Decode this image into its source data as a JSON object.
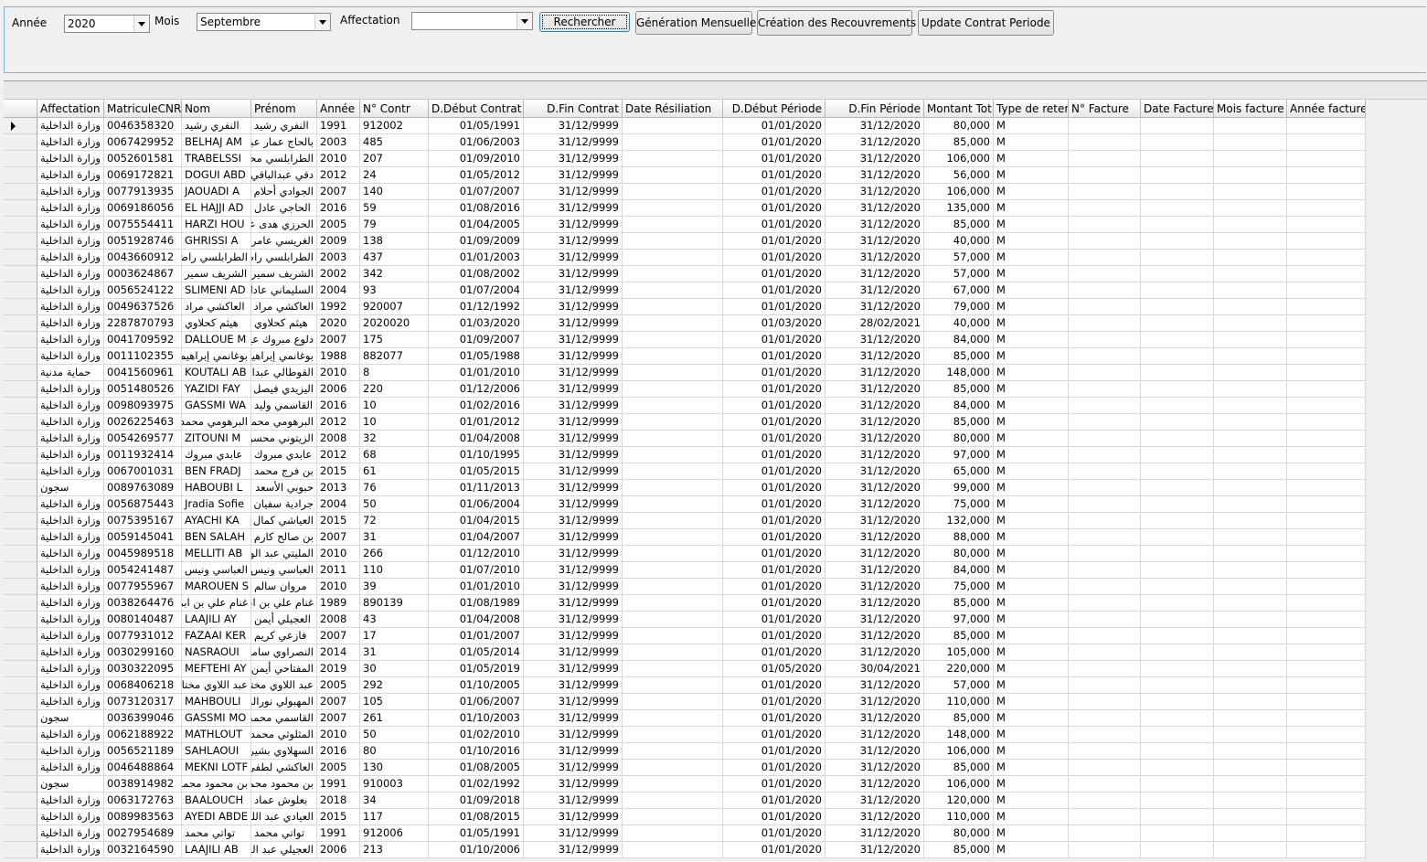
{
  "filters": {
    "annee_label": "Année",
    "annee_value": "2020",
    "mois_label": "Mois",
    "mois_value": "Septembre",
    "affectation_label": "Affectation",
    "affectation_value": ""
  },
  "buttons": {
    "rechercher": "Rechercher",
    "generation": "Génération Mensuelle",
    "creation": "Création des Recouvrements",
    "update": "Update Contrat Periode"
  },
  "grid": {
    "columns": [
      "Affectation",
      "MatriculeCNR",
      "Nom",
      "Prénom",
      "Année",
      "N° Contr",
      "D.Début Contrat",
      "D.Fin Contrat",
      "Date Résiliation",
      "D.Début Période",
      "D.Fin Période",
      "Montant Tot",
      "Type de reten",
      "N° Facture",
      "Date Facture",
      "Mois facture",
      "Année facture"
    ],
    "rows": [
      [
        "وزارة الداخلية",
        "0046358320",
        "النفري رشيد",
        "النفري رشيد",
        "1991",
        "912002",
        "01/05/1991",
        "31/12/9999",
        "",
        "01/01/2020",
        "31/12/2020",
        "80,000",
        "M",
        "",
        "",
        "",
        ""
      ],
      [
        "وزارة الداخلية",
        "0067429952",
        "BELHAJ AM",
        "بالحاج عمار عبد",
        "2003",
        "485",
        "01/06/2003",
        "31/12/9999",
        "",
        "01/01/2020",
        "31/12/2020",
        "85,000",
        "M",
        "",
        "",
        "",
        ""
      ],
      [
        "وزارة الداخلية",
        "0052601581",
        "TRABELSSI",
        "الطرابلسي محمد",
        "2010",
        "207",
        "01/09/2010",
        "31/12/9999",
        "",
        "01/01/2020",
        "31/12/2020",
        "106,000",
        "M",
        "",
        "",
        "",
        ""
      ],
      [
        "وزارة الداخلية",
        "0069172821",
        "DOGUI ABD",
        "دقي عبدالباقي",
        "2012",
        "24",
        "01/05/2012",
        "31/12/9999",
        "",
        "01/01/2020",
        "31/12/2020",
        "56,000",
        "M",
        "",
        "",
        "",
        ""
      ],
      [
        "وزارة الداخلية",
        "0077913935",
        "JAOUADI A",
        "الجوادي أحلام",
        "2007",
        "140",
        "01/07/2007",
        "31/12/9999",
        "",
        "01/01/2020",
        "31/12/2020",
        "106,000",
        "M",
        "",
        "",
        "",
        ""
      ],
      [
        "وزارة الداخلية",
        "0069186056",
        "EL HAJJI AD",
        "الحاجي عادل",
        "2016",
        "59",
        "01/08/2016",
        "31/12/9999",
        "",
        "01/01/2020",
        "31/12/2020",
        "135,000",
        "M",
        "",
        "",
        "",
        ""
      ],
      [
        "وزارة الداخلية",
        "0075554411",
        "HARZI HOU",
        "الحرزي هدى عد",
        "2005",
        "79",
        "01/04/2005",
        "31/12/9999",
        "",
        "01/01/2020",
        "31/12/2020",
        "85,000",
        "M",
        "",
        "",
        "",
        ""
      ],
      [
        "وزارة الداخلية",
        "0051928746",
        "GHRISSI A",
        "الغريسي عامر",
        "2009",
        "138",
        "01/09/2009",
        "31/12/9999",
        "",
        "01/01/2020",
        "31/12/2020",
        "40,000",
        "M",
        "",
        "",
        "",
        ""
      ],
      [
        "وزارة الداخلية",
        "0043660912",
        "الطرابلسي راضيا",
        "الطرابلسي راضي",
        "2003",
        "437",
        "01/01/2003",
        "31/12/9999",
        "",
        "01/01/2020",
        "31/12/2020",
        "57,000",
        "M",
        "",
        "",
        "",
        ""
      ],
      [
        "وزارة الداخلية",
        "0003624867",
        "الشريف سمير",
        "الشريف سمير",
        "2002",
        "342",
        "01/08/2002",
        "31/12/9999",
        "",
        "01/01/2020",
        "31/12/2020",
        "57,000",
        "M",
        "",
        "",
        "",
        ""
      ],
      [
        "وزارة الداخلية",
        "0056524122",
        "SLIMENI AD",
        "السليماني عادل",
        "2004",
        "93",
        "01/07/2004",
        "31/12/9999",
        "",
        "01/01/2020",
        "31/12/2020",
        "67,000",
        "M",
        "",
        "",
        "",
        ""
      ],
      [
        "وزارة الداخلية",
        "0049637526",
        "العاكشي مراد",
        "العاكشي مراد",
        "1992",
        "920007",
        "01/12/1992",
        "31/12/9999",
        "",
        "01/01/2020",
        "31/12/2020",
        "79,000",
        "M",
        "",
        "",
        "",
        ""
      ],
      [
        "وزارة الداخلية",
        "2287870793",
        "هيثم كحلاوي",
        "هيثم كحلاوي",
        "2020",
        "2020020",
        "01/03/2020",
        "31/12/9999",
        "",
        "01/03/2020",
        "28/02/2021",
        "40,000",
        "M",
        "",
        "",
        "",
        ""
      ],
      [
        "وزارة الداخلية",
        "0041709592",
        "DALLOUE M",
        "دلوع مبروك عياد",
        "2007",
        "175",
        "01/09/2007",
        "31/12/9999",
        "",
        "01/01/2020",
        "31/12/2020",
        "84,000",
        "M",
        "",
        "",
        "",
        ""
      ],
      [
        "وزارة الداخلية",
        "0011102355",
        "بوغانمي إبراهيم",
        "بوغانمي إبراهيم",
        "1988",
        "882077",
        "01/05/1988",
        "31/12/9999",
        "",
        "01/01/2020",
        "31/12/2020",
        "85,000",
        "M",
        "",
        "",
        "",
        ""
      ],
      [
        "حماية مدنية",
        "0041560961",
        "KOUTALI AB",
        "القوطالي عبدالرح",
        "2010",
        "8",
        "01/01/2010",
        "31/12/9999",
        "",
        "01/01/2020",
        "31/12/2020",
        "148,000",
        "M",
        "",
        "",
        "",
        ""
      ],
      [
        "وزارة الداخلية",
        "0051480526",
        "YAZIDI FAY",
        "اليزيدي فيصل",
        "2006",
        "220",
        "01/12/2006",
        "31/12/9999",
        "",
        "01/01/2020",
        "31/12/2020",
        "85,000",
        "M",
        "",
        "",
        "",
        ""
      ],
      [
        "وزارة الداخلية",
        "0098093975",
        "GASSMI WA",
        "القاسمي وليد",
        "2016",
        "10",
        "01/02/2016",
        "31/12/9999",
        "",
        "01/01/2020",
        "31/12/2020",
        "84,000",
        "M",
        "",
        "",
        "",
        ""
      ],
      [
        "وزارة الداخلية",
        "0026225463",
        "البرهومي محمد",
        "البرهومي محمد",
        "2012",
        "10",
        "01/01/2012",
        "31/12/9999",
        "",
        "01/01/2020",
        "31/12/2020",
        "85,000",
        "M",
        "",
        "",
        "",
        ""
      ],
      [
        "وزارة الداخلية",
        "0054269577",
        "ZITOUNI M",
        "الزيتوني محسن",
        "2008",
        "32",
        "01/04/2008",
        "31/12/9999",
        "",
        "01/01/2020",
        "31/12/2020",
        "80,000",
        "M",
        "",
        "",
        "",
        ""
      ],
      [
        "وزارة الداخلية",
        "0011932414",
        "عابدي مبروك",
        "عابدي مبروك",
        "2012",
        "68",
        "01/10/1995",
        "31/12/9999",
        "",
        "01/01/2020",
        "31/12/2020",
        "97,000",
        "M",
        "",
        "",
        "",
        ""
      ],
      [
        "وزارة الداخلية",
        "0067001031",
        "BEN FRADJ",
        "بن فرج محمد",
        "2015",
        "61",
        "01/05/2015",
        "31/12/9999",
        "",
        "01/01/2020",
        "31/12/2020",
        "65,000",
        "M",
        "",
        "",
        "",
        ""
      ],
      [
        "سجون",
        "0089763089",
        "HABOUBI L",
        "حبوبي الأسعد بن",
        "2013",
        "76",
        "01/11/2013",
        "31/12/9999",
        "",
        "01/01/2020",
        "31/12/2020",
        "99,000",
        "M",
        "",
        "",
        "",
        ""
      ],
      [
        "وزارة الداخلية",
        "0056875443",
        "Jradia Sofie",
        "جرادية سفيان ب",
        "2004",
        "50",
        "01/06/2004",
        "31/12/9999",
        "",
        "01/01/2020",
        "31/12/2020",
        "75,000",
        "M",
        "",
        "",
        "",
        ""
      ],
      [
        "وزارة الداخلية",
        "0075395167",
        "AYACHI KA",
        "العياشي كمال",
        "2015",
        "72",
        "01/04/2015",
        "31/12/9999",
        "",
        "01/01/2020",
        "31/12/2020",
        "132,000",
        "M",
        "",
        "",
        "",
        ""
      ],
      [
        "وزارة الداخلية",
        "0059145041",
        "BEN SALAH",
        "بن صالح كارم",
        "2007",
        "31",
        "01/04/2007",
        "31/12/9999",
        "",
        "01/01/2020",
        "31/12/2020",
        "88,000",
        "M",
        "",
        "",
        "",
        ""
      ],
      [
        "وزارة الداخلية",
        "0045989518",
        "MELLITI AB",
        "المليتي عبد الوها",
        "2010",
        "266",
        "01/12/2010",
        "31/12/9999",
        "",
        "01/01/2020",
        "31/12/2020",
        "80,000",
        "M",
        "",
        "",
        "",
        ""
      ],
      [
        "وزارة الداخلية",
        "0054241487",
        "العباسي ونيس",
        "العباسي ونيس",
        "2011",
        "110",
        "01/07/2010",
        "31/12/9999",
        "",
        "01/01/2020",
        "31/12/2020",
        "84,000",
        "M",
        "",
        "",
        "",
        ""
      ],
      [
        "وزارة الداخلية",
        "0077955967",
        "MAROUEN S",
        "مروان سالم",
        "2010",
        "39",
        "01/01/2010",
        "31/12/9999",
        "",
        "01/01/2020",
        "31/12/2020",
        "75,000",
        "M",
        "",
        "",
        "",
        ""
      ],
      [
        "وزارة الداخلية",
        "0038264476",
        "غنام علي بن ابرا",
        "غنام علي بن ابرا",
        "1989",
        "890139",
        "01/08/1989",
        "31/12/9999",
        "",
        "01/01/2020",
        "31/12/2020",
        "85,000",
        "M",
        "",
        "",
        "",
        ""
      ],
      [
        "وزارة الداخلية",
        "0080140487",
        "LAAJILI AY",
        "العجيلي أيمن",
        "2008",
        "43",
        "01/04/2008",
        "31/12/9999",
        "",
        "01/01/2020",
        "31/12/2020",
        "97,000",
        "M",
        "",
        "",
        "",
        ""
      ],
      [
        "وزارة الداخلية",
        "0077931012",
        "FAZAAI KER",
        "فازعي كريم",
        "2007",
        "17",
        "01/01/2007",
        "31/12/9999",
        "",
        "01/01/2020",
        "31/12/2020",
        "85,000",
        "M",
        "",
        "",
        "",
        ""
      ],
      [
        "وزارة الداخلية",
        "0030299160",
        "NASRAOUI",
        "النصراوي سامي",
        "2014",
        "31",
        "01/05/2014",
        "31/12/9999",
        "",
        "01/01/2020",
        "31/12/2020",
        "105,000",
        "M",
        "",
        "",
        "",
        ""
      ],
      [
        "وزارة الداخلية",
        "0030322095",
        "MEFTEHI AY",
        "المفتاحي أيمن",
        "2019",
        "30",
        "01/05/2019",
        "31/12/9999",
        "",
        "01/05/2020",
        "30/04/2021",
        "220,000",
        "M",
        "",
        "",
        "",
        ""
      ],
      [
        "وزارة الداخلية",
        "0068406218",
        "عبد اللاوي مختا",
        "عبد اللاوي مختا",
        "2005",
        "292",
        "01/10/2005",
        "31/12/9999",
        "",
        "01/01/2020",
        "31/12/2020",
        "57,000",
        "M",
        "",
        "",
        "",
        ""
      ],
      [
        "وزارة الداخلية",
        "0073120317",
        "MAHBOULI",
        "المهبولي نورالدين",
        "2007",
        "105",
        "01/06/2007",
        "31/12/9999",
        "",
        "01/01/2020",
        "31/12/2020",
        "110,000",
        "M",
        "",
        "",
        "",
        ""
      ],
      [
        "سجون",
        "0036399046",
        "GASSMI MO",
        "القاسمي محمد ص",
        "2007",
        "261",
        "01/10/2003",
        "31/12/9999",
        "",
        "01/01/2020",
        "31/12/2020",
        "85,000",
        "M",
        "",
        "",
        "",
        ""
      ],
      [
        "وزارة الداخلية",
        "0062188922",
        "MATHLOUT",
        "المثلوثي محمد بن",
        "2010",
        "50",
        "01/02/2010",
        "31/12/9999",
        "",
        "01/01/2020",
        "31/12/2020",
        "148,000",
        "M",
        "",
        "",
        "",
        ""
      ],
      [
        "وزارة الداخلية",
        "0056521189",
        "SAHLAOUI",
        "السهلاوي بشير",
        "2016",
        "80",
        "01/10/2016",
        "31/12/9999",
        "",
        "01/01/2020",
        "31/12/2020",
        "106,000",
        "M",
        "",
        "",
        "",
        ""
      ],
      [
        "وزارة الداخلية",
        "0046488864",
        "MEKNI LOTF",
        "العاكشي لطفي أد",
        "2005",
        "130",
        "01/08/2005",
        "31/12/9999",
        "",
        "01/01/2020",
        "31/12/2020",
        "85,000",
        "M",
        "",
        "",
        "",
        ""
      ],
      [
        "سجون",
        "0038914982",
        "بن محمود محمد",
        "بن محمود محمد",
        "1991",
        "910003",
        "01/02/1992",
        "31/12/9999",
        "",
        "01/01/2020",
        "31/12/2020",
        "106,000",
        "M",
        "",
        "",
        "",
        ""
      ],
      [
        "وزارة الداخلية",
        "0063172763",
        "BAALOUCH",
        "بعلوش عماد",
        "2018",
        "34",
        "01/09/2018",
        "31/12/9999",
        "",
        "01/01/2020",
        "31/12/2020",
        "120,000",
        "M",
        "",
        "",
        "",
        ""
      ],
      [
        "وزارة الداخلية",
        "0089983563",
        "AYEDI ABDE",
        "العيادي عبد اللط",
        "2015",
        "117",
        "01/08/2015",
        "31/12/9999",
        "",
        "01/01/2020",
        "31/12/2020",
        "110,000",
        "M",
        "",
        "",
        "",
        ""
      ],
      [
        "وزارة الداخلية",
        "0027954689",
        "تواتي محمد",
        "تواتي محمد",
        "1991",
        "912006",
        "01/05/1991",
        "31/12/9999",
        "",
        "01/01/2020",
        "31/12/2020",
        "80,000",
        "M",
        "",
        "",
        "",
        ""
      ],
      [
        "وزارة الداخلية",
        "0032164590",
        "LAAJILI AB",
        "العجيلي عبد النا",
        "2006",
        "213",
        "01/10/2006",
        "31/12/9999",
        "",
        "01/01/2020",
        "31/12/2020",
        "85,000",
        "M",
        "",
        "",
        "",
        ""
      ]
    ]
  }
}
